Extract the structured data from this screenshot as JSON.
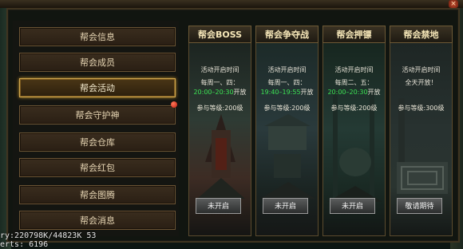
{
  "header": {
    "title": "",
    "close_label": "×"
  },
  "sidebar": {
    "items": [
      {
        "label": "帮会信息"
      },
      {
        "label": "帮会成员"
      },
      {
        "label": "帮会活动",
        "active": true
      },
      {
        "label": "帮会守护神",
        "badge": true
      },
      {
        "label": "帮会仓库"
      },
      {
        "label": "帮会红包"
      },
      {
        "label": "帮会图腾"
      },
      {
        "label": "帮会消息"
      }
    ]
  },
  "cards": [
    {
      "title": "帮会BOSS",
      "open_time_label": "活动开启时间",
      "days": "每周一、四：",
      "time": "20:00–20:30",
      "time_suffix": "开放",
      "level": "参与等级:200级",
      "button": "未开启",
      "theme": "#2e3b34"
    },
    {
      "title": "帮会争夺战",
      "open_time_label": "活动开启时间",
      "days": "每周一、四：",
      "time": "19:40–19:55",
      "time_suffix": "开放",
      "level": "参与等级:200级",
      "button": "未开启",
      "theme": "#2a3a3c"
    },
    {
      "title": "帮会押镖",
      "open_time_label": "活动开启时间",
      "days": "每周二、五：",
      "time": "20:00–20:30",
      "time_suffix": "开放",
      "level": "参与等级:200级",
      "button": "未开启",
      "theme": "#243a34"
    },
    {
      "title": "帮会禁地",
      "open_time_label": "活动开启时间",
      "days": "全天开放！",
      "time": "",
      "time_suffix": "",
      "level": "参与等级:300级",
      "button": "敬请期待",
      "theme": "#283230"
    }
  ],
  "console": {
    "line1": "ry:220798K/44823K 53",
    "line2": "erts:    6196"
  },
  "colors": {
    "accent": "#d2a84e",
    "green_time": "#3de254",
    "badge": "#c21c10"
  }
}
